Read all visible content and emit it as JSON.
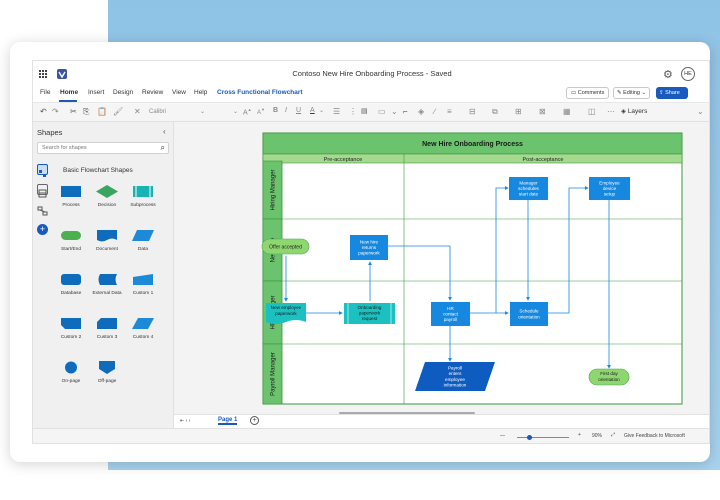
{
  "title_bar": {
    "document_title": "Contoso New Hire Onboarding Process  -  Saved",
    "user_initials": "HE",
    "settings_icon": "gear-icon"
  },
  "menu": {
    "items": [
      "File",
      "Home",
      "Insert",
      "Design",
      "Review",
      "View",
      "Help"
    ],
    "active": "Home",
    "contextual_tab": "Cross Functional Flowchart",
    "comments_label": "Comments",
    "editing_label": "Editing",
    "share_label": "Share"
  },
  "ribbon": {
    "font_name": "Calibri",
    "layers_label": "Layers",
    "font_size_label": "A"
  },
  "shapes_panel": {
    "title": "Shapes",
    "search_placeholder": "Search for shapes",
    "category": "Basic Flowchart Shapes",
    "stencils": [
      {
        "label": "Process",
        "shape": "rect",
        "color": "#0f6cbd"
      },
      {
        "label": "Decision",
        "shape": "diamond",
        "color": "#3aa55e"
      },
      {
        "label": "Subprocess",
        "shape": "subprocess",
        "color": "#1ab2b2"
      },
      {
        "label": "Start/End",
        "shape": "pill",
        "color": "#4caf50"
      },
      {
        "label": "Document",
        "shape": "document",
        "color": "#0f6cbd"
      },
      {
        "label": "Data",
        "shape": "data",
        "color": "#1d8ad8"
      },
      {
        "label": "Database",
        "shape": "database",
        "color": "#0f6cbd"
      },
      {
        "label": "External Data",
        "shape": "external",
        "color": "#0f6cbd"
      },
      {
        "label": "Custom 1",
        "shape": "custom1",
        "color": "#1d8ad8"
      },
      {
        "label": "Custom 2",
        "shape": "custom2",
        "color": "#0f6cbd"
      },
      {
        "label": "Custom 3",
        "shape": "custom3",
        "color": "#0f6cbd"
      },
      {
        "label": "Custom 4",
        "shape": "custom4",
        "color": "#1d8ad8"
      },
      {
        "label": "On-page",
        "shape": "circle",
        "color": "#0f6cbd"
      },
      {
        "label": "Off-page",
        "shape": "offpage",
        "color": "#0f6cbd"
      }
    ]
  },
  "diagram": {
    "title": "New Hire Onboarding Process",
    "phases": [
      "Pre-acceptance",
      "Post-acceptance"
    ],
    "lanes": [
      "Hiring Manager",
      "New Hire",
      "HR Manager",
      "Payroll Manager"
    ],
    "shapes": {
      "mgr_schedule": "Manager schedules start date",
      "employee_device": "Employee device setup",
      "offer_accepted": "Offer accepted",
      "returns_paperwork": "New hire returns paperwork",
      "new_employee_paperwork": "New employee paperwork",
      "onboarding_paperwork": "Onboarding paperwork request",
      "hr_contact_payroll": "HR contact payroll",
      "schedule_orientation": "Schedule orientation",
      "payroll_enters": "Payroll enters employee information",
      "first_day": "First day orientation"
    },
    "colors": {
      "lane_green": "#6cc36e",
      "lane_border": "#3a9a3e",
      "process_blue": "#1788e0",
      "teal": "#1bc1c1",
      "pill_green": "#8ed66f"
    }
  },
  "status": {
    "page_tab": "Page 1",
    "zoom": "90%",
    "feedback": "Give Feedback to Microsoft"
  }
}
